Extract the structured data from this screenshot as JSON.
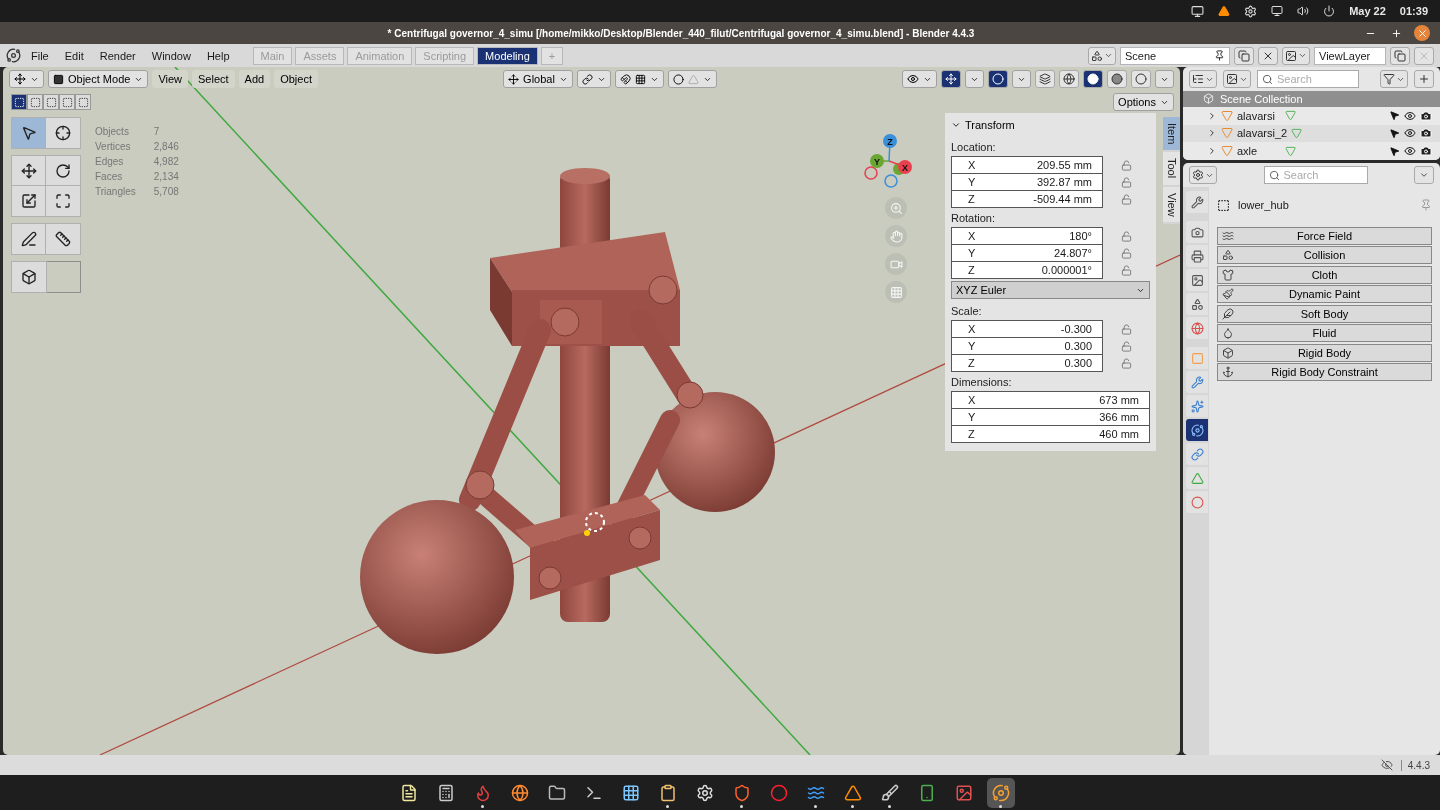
{
  "system_bar": {
    "date": "May 22",
    "time": "01:39"
  },
  "window": {
    "title": "* Centrifugal governor_4_simu [/home/mikko/Desktop/Blender_440_filut/Centrifugal governor_4_simu.blend] - Blender 4.4.3"
  },
  "menu": [
    "File",
    "Edit",
    "Render",
    "Window",
    "Help"
  ],
  "workspaces": [
    {
      "label": "Main",
      "selected": false
    },
    {
      "label": "Assets",
      "selected": false
    },
    {
      "label": "Animation",
      "selected": false
    },
    {
      "label": "Scripting",
      "selected": false
    },
    {
      "label": "Modeling",
      "selected": true
    }
  ],
  "add_workspace": "+",
  "scene": {
    "name": "Scene"
  },
  "view_layer": {
    "name": "ViewLayer"
  },
  "viewport": {
    "mode": "Object Mode",
    "menus": [
      "View",
      "Select",
      "Add",
      "Object"
    ],
    "orientation": "Global",
    "options": "Options",
    "select_modes": [
      {
        "selected": true
      },
      {
        "selected": false
      },
      {
        "selected": false
      },
      {
        "selected": false
      },
      {
        "selected": false
      }
    ],
    "tools": [
      {
        "kind": "select",
        "selected": true
      },
      {
        "kind": "cursor",
        "selected": false
      },
      {
        "kind": "move",
        "selected": false
      },
      {
        "kind": "rotate",
        "selected": false
      },
      {
        "kind": "scale",
        "selected": false
      },
      {
        "kind": "transform",
        "selected": false
      },
      {
        "kind": "annotate",
        "selected": false
      },
      {
        "kind": "measure",
        "selected": false
      },
      {
        "kind": "add_cube",
        "selected": false
      }
    ],
    "stats": [
      {
        "label": "Objects",
        "value": "7"
      },
      {
        "label": "Vertices",
        "value": "2,846"
      },
      {
        "label": "Edges",
        "value": "4,982"
      },
      {
        "label": "Faces",
        "value": "2,134"
      },
      {
        "label": "Triangles",
        "value": "5,708"
      }
    ],
    "gizmo_axes": [
      {
        "label": "X",
        "color": "#e8404f"
      },
      {
        "label": "Y",
        "color": "#6aa632"
      },
      {
        "label": "Z",
        "color": "#3a8fd9"
      }
    ],
    "sidebar_tabs": [
      {
        "label": "Item",
        "selected": true
      },
      {
        "label": "Tool",
        "selected": false
      },
      {
        "label": "View",
        "selected": false
      }
    ],
    "transform": {
      "title": "Transform",
      "expanded": true,
      "groups": [
        {
          "label": "Location:",
          "kind": "lockable",
          "fields": [
            {
              "axis": "X",
              "value": "209.55 mm",
              "locked": false
            },
            {
              "axis": "Y",
              "value": "392.87 mm",
              "locked": false
            },
            {
              "axis": "Z",
              "value": "-509.44 mm",
              "locked": false
            }
          ]
        },
        {
          "label": "Rotation:",
          "kind": "lockable",
          "mode": "XYZ Euler",
          "fields": [
            {
              "axis": "X",
              "value": "180°",
              "locked": false
            },
            {
              "axis": "Y",
              "value": "24.807°",
              "locked": false
            },
            {
              "axis": "Z",
              "value": "0.000001°",
              "locked": false
            }
          ]
        },
        {
          "label": "Scale:",
          "kind": "lockable",
          "fields": [
            {
              "axis": "X",
              "value": "-0.300",
              "locked": false
            },
            {
              "axis": "Y",
              "value": "0.300",
              "locked": false
            },
            {
              "axis": "Z",
              "value": "0.300",
              "locked": false
            }
          ]
        },
        {
          "label": "Dimensions:",
          "kind": "plain",
          "fields": [
            {
              "axis": "X",
              "value": "673 mm"
            },
            {
              "axis": "Y",
              "value": "366 mm"
            },
            {
              "axis": "Z",
              "value": "460 mm"
            }
          ]
        }
      ]
    }
  },
  "outliner": {
    "search_placeholder": "Search",
    "root": "Scene Collection",
    "items": [
      {
        "name": "alavarsi",
        "visible": true
      },
      {
        "name": "alavarsi_2",
        "visible": true
      },
      {
        "name": "axle",
        "visible": true
      }
    ]
  },
  "properties": {
    "search_placeholder": "Search",
    "object": "lower_hub",
    "tabs": [
      {
        "kind": "tool",
        "selected": false
      },
      {
        "kind": "render",
        "selected": false
      },
      {
        "kind": "output",
        "selected": false
      },
      {
        "kind": "view_layer",
        "selected": false
      },
      {
        "kind": "scene",
        "selected": false
      },
      {
        "kind": "world",
        "selected": false
      },
      {
        "kind": "object",
        "selected": false
      },
      {
        "kind": "modifiers",
        "selected": false
      },
      {
        "kind": "particles",
        "selected": false
      },
      {
        "kind": "physics",
        "selected": true
      },
      {
        "kind": "constraints",
        "selected": false
      },
      {
        "kind": "data",
        "selected": false
      },
      {
        "kind": "material",
        "selected": false
      }
    ],
    "physics": [
      {
        "kind": "force_field",
        "label": "Force Field"
      },
      {
        "kind": "collision",
        "label": "Collision"
      },
      {
        "kind": "cloth",
        "label": "Cloth"
      },
      {
        "kind": "dynamic_paint",
        "label": "Dynamic Paint"
      },
      {
        "kind": "soft_body",
        "label": "Soft Body"
      },
      {
        "kind": "fluid",
        "label": "Fluid"
      },
      {
        "kind": "rigid_body",
        "label": "Rigid Body"
      },
      {
        "kind": "rigid_body_constraint",
        "label": "Rigid Body Constraint"
      }
    ]
  },
  "status_bar": {
    "version": "4.4.3"
  },
  "taskbar": {
    "apps": [
      {
        "kind": "notes",
        "running": false,
        "selected": false
      },
      {
        "kind": "calculator",
        "running": false,
        "selected": false
      },
      {
        "kind": "flame",
        "running": true,
        "selected": false
      },
      {
        "kind": "browser",
        "running": false,
        "selected": false
      },
      {
        "kind": "files",
        "running": false,
        "selected": false
      },
      {
        "kind": "terminal",
        "running": false,
        "selected": false
      },
      {
        "kind": "apps",
        "running": false,
        "selected": false
      },
      {
        "kind": "clipboard",
        "running": true,
        "selected": false
      },
      {
        "kind": "settings",
        "running": false,
        "selected": false
      },
      {
        "kind": "shield",
        "running": true,
        "selected": false
      },
      {
        "kind": "ring",
        "running": false,
        "selected": false
      },
      {
        "kind": "waves",
        "running": true,
        "selected": false
      },
      {
        "kind": "cone",
        "running": true,
        "selected": false
      },
      {
        "kind": "brush",
        "running": true,
        "selected": false
      },
      {
        "kind": "phone",
        "running": false,
        "selected": false
      },
      {
        "kind": "image",
        "running": false,
        "selected": false
      },
      {
        "kind": "blender",
        "running": true,
        "selected": true
      }
    ]
  }
}
